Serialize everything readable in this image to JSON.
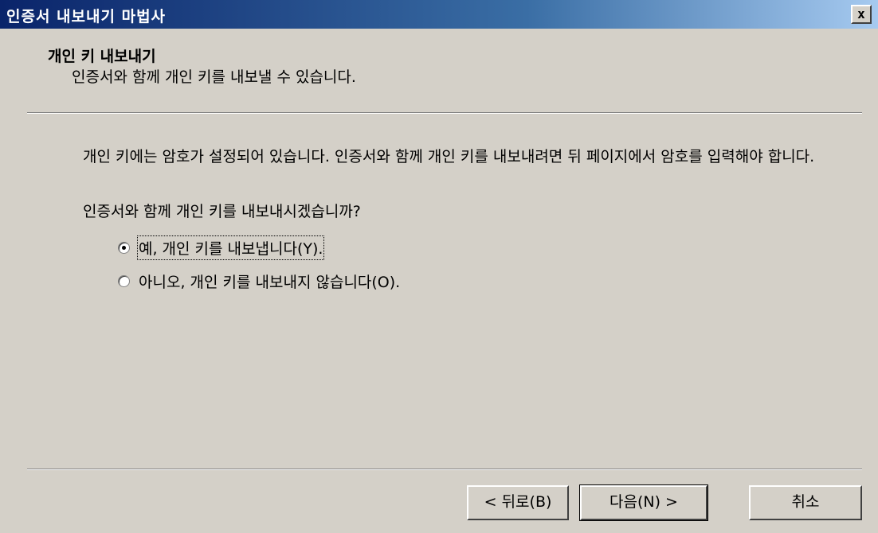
{
  "window": {
    "title": "인증서 내보내기 마법사",
    "close_glyph": "x"
  },
  "header": {
    "heading": "개인 키 내보내기",
    "subheading": "인증서와 함께 개인 키를 내보낼 수 있습니다."
  },
  "content": {
    "paragraph": "개인 키에는 암호가 설정되어 있습니다. 인증서와 함께 개인 키를 내보내려면 뒤 페이지에서 암호를 입력해야 합니다.",
    "question": "인증서와 함께 개인 키를 내보내시겠습니까?",
    "options": [
      {
        "label": "예, 개인 키를 내보냅니다(Y).",
        "selected": true
      },
      {
        "label": "아니오, 개인 키를 내보내지 않습니다(O).",
        "selected": false
      }
    ]
  },
  "buttons": {
    "back": "< 뒤로(B)",
    "next": "다음(N) >",
    "cancel": "취소"
  }
}
